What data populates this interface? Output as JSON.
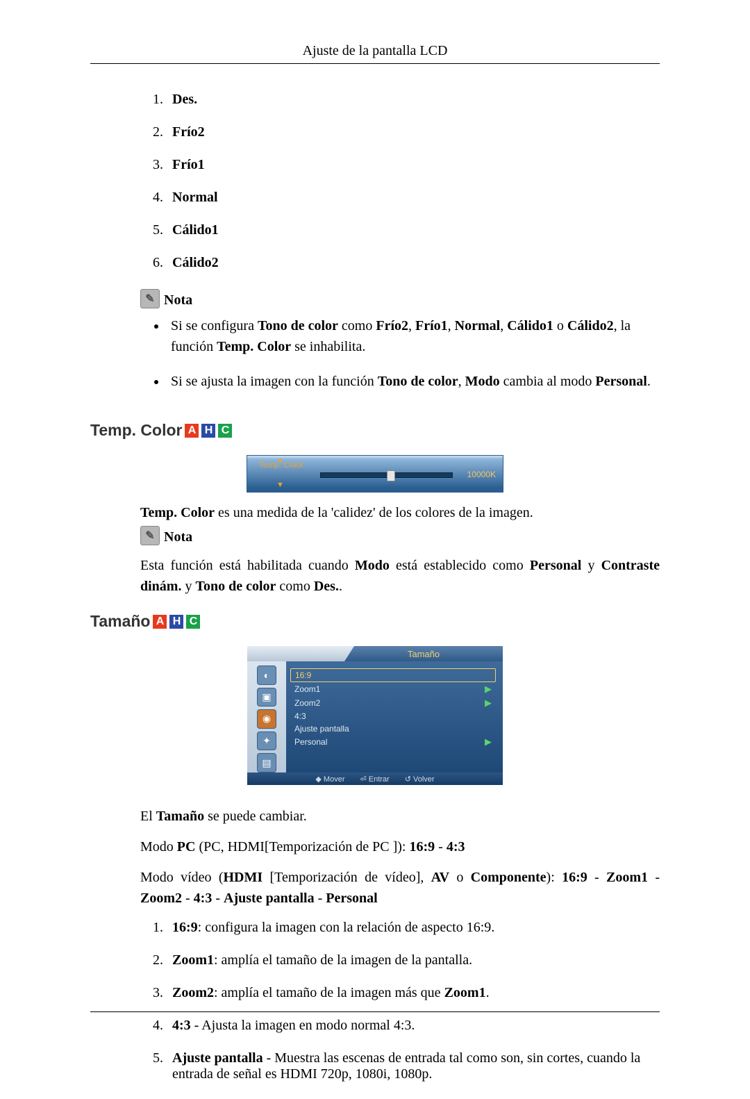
{
  "header": {
    "title": "Ajuste de la pantalla LCD"
  },
  "toneList": {
    "items": [
      "Des.",
      "Frío2",
      "Frío1",
      "Normal",
      "Cálido1",
      "Cálido2"
    ]
  },
  "nota1": {
    "label": "Nota",
    "bullets": [
      "Si se configura <b>Tono de color</b> como <b>Frío2</b>, <b>Frío1</b>, <b>Normal</b>, <b>Cálido1</b> o <b>Cálido2</b>, la función <b>Temp. Color</b> se inhabilita.",
      "Si se ajusta la imagen con la función <b>Tono de color</b>, <b>Modo</b> cambia al modo <b>Personal</b>."
    ]
  },
  "tempColor": {
    "heading": "Temp. Color",
    "badges": [
      "A",
      "H",
      "C"
    ],
    "sliderLabel": "Temp. Color",
    "sliderValue": "10000K",
    "desc": "<b>Temp. Color</b> es una medida de la 'calidez' de los colores de la imagen.",
    "notaLabel": "Nota",
    "notaText": "Esta función está habilitada cuando <b>Modo</b> está establecido como <b>Personal</b> y <b>Contraste dinám.</b> y <b>Tono de color</b> como <b>Des.</b>."
  },
  "tamano": {
    "heading": "Tamaño",
    "badges": [
      "A",
      "H",
      "C"
    ],
    "menuTitle": "Tamaño",
    "menuItems": [
      {
        "label": "16:9",
        "sel": true,
        "arrow": false
      },
      {
        "label": "Zoom1",
        "sel": false,
        "arrow": true
      },
      {
        "label": "Zoom2",
        "sel": false,
        "arrow": true
      },
      {
        "label": "4:3",
        "sel": false,
        "arrow": false
      },
      {
        "label": "Ajuste pantalla",
        "sel": false,
        "arrow": false
      },
      {
        "label": "Personal",
        "sel": false,
        "arrow": true
      }
    ],
    "menuFooter": [
      "◆ Mover",
      "⏎ Entrar",
      "↺ Volver"
    ],
    "p1": "El <b>Tamaño</b> se puede cambiar.",
    "p2": "Modo <b>PC</b> (PC, HDMI[Temporización de PC ]): <b>16:9</b> - <b>4:3</b>",
    "p3": "Modo vídeo (<b>HDMI</b> [Temporización de vídeo], <b>AV</b> o <b>Componente</b>): <b>16:9</b> - <b>Zoom1</b> - <b>Zoom2</b> - <b>4:3</b> - <b>Ajuste pantalla</b> - <b>Personal</b>",
    "sizeList": [
      "<b>16:9</b>: configura la imagen con la relación de aspecto 16:9.",
      "<b>Zoom1</b>: amplía el tamaño de la imagen de la pantalla.",
      "<b>Zoom2</b>: amplía el tamaño de la imagen más que <b>Zoom1</b>.",
      "<b>4:3</b> - Ajusta la imagen en modo normal 4:3.",
      "<b>Ajuste pantalla</b> - Muestra las escenas de entrada tal como son, sin cortes, cuando la entrada de señal es HDMI 720p, 1080i, 1080p."
    ]
  }
}
